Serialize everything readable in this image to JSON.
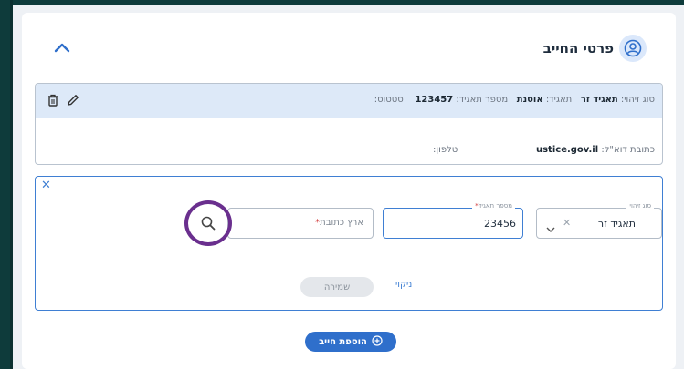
{
  "header": {
    "title": "פרטי החייב",
    "icon": "user-circle-icon",
    "collapse_icon": "chevron-up-icon"
  },
  "summary": {
    "id_type_label": "סוג זיהוי:",
    "id_type_value": "תאגיד זר",
    "corp_label": "תאגיד:",
    "corp_value": "אוסנת",
    "corp_num_label": "מספר תאגיד:",
    "corp_num_value": "123457",
    "status_label": "סטטוס:",
    "email_label": "כתובת דוא\"ל:",
    "email_value": "ustice.gov.il",
    "phone_label": "טלפון:",
    "actions": {
      "edit_icon": "pencil-icon",
      "delete_icon": "trash-icon"
    }
  },
  "form": {
    "close_icon": "close-icon",
    "id_type": {
      "legend": "סוג זיהוי",
      "value": "תאגיד זר"
    },
    "corp_number": {
      "legend": "מספר תאגיד",
      "value": "23456"
    },
    "country": {
      "placeholder": "ארץ כתובת"
    },
    "search_icon": "search-icon",
    "save_label": "שמירה",
    "clear_label": "ניקוי"
  },
  "add_button": {
    "label": "הוספת חייב",
    "icon": "plus-circle-icon"
  },
  "colors": {
    "accent": "#3f7fd3",
    "highlight_ring": "#6a2f8e",
    "summary_bg": "#dde9f8"
  }
}
